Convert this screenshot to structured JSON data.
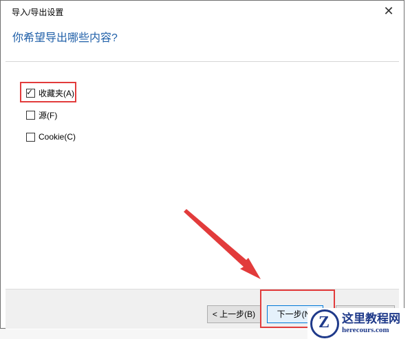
{
  "dialog": {
    "title": "导入/导出设置",
    "close_symbol": "✕",
    "question": "你希望导出哪些内容?"
  },
  "options": [
    {
      "label": "收藏夹(A)",
      "checked": true
    },
    {
      "label": "源(F)",
      "checked": false
    },
    {
      "label": "Cookie(C)",
      "checked": false
    }
  ],
  "buttons": {
    "back": "< 上一步(B)",
    "next": "下一步(N)"
  },
  "watermark": {
    "logo_letter": "Z",
    "title": "这里教程网",
    "url": "herecours.com"
  },
  "colors": {
    "highlight": "#e23b3b",
    "question": "#1f5fa8",
    "watermark": "#1f3a8a"
  }
}
